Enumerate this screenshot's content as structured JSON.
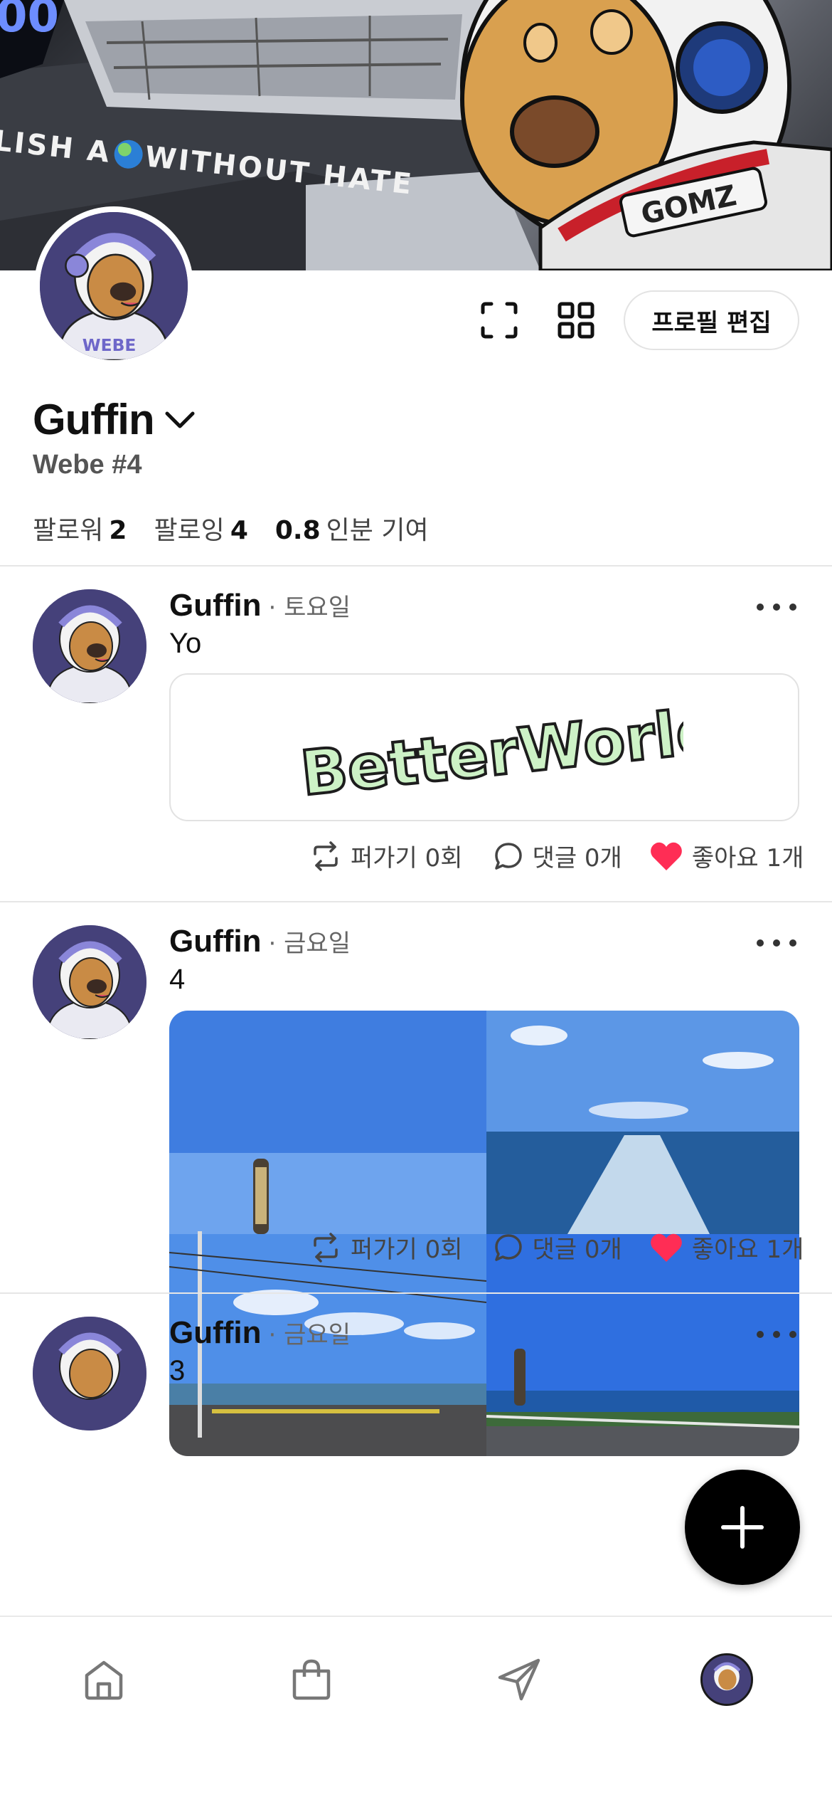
{
  "banner": {
    "text": "LISH A",
    "text_after": "WITHOUT HATE",
    "suit_text": "GOMZ"
  },
  "header": {
    "edit_profile_label": "프로필 편집"
  },
  "profile": {
    "name": "Guffin",
    "handle": "Webe #4",
    "followers_label": "팔로워",
    "followers_count": "2",
    "following_label": "팔로잉",
    "following_count": "4",
    "contribution_value": "0.8",
    "contribution_label": "인분 기여"
  },
  "posts": [
    {
      "author": "Guffin",
      "time": "· 토요일",
      "text": "Yo",
      "link_card_logo": "BetterWorld",
      "repost_label": "퍼가기 0회",
      "comment_label": "댓글 0개",
      "like_label": "좋아요 1개"
    },
    {
      "author": "Guffin",
      "time": "· 금요일",
      "text": "4",
      "repost_label": "퍼가기 0회",
      "comment_label": "댓글 0개",
      "like_label": "좋아요 1개"
    },
    {
      "author": "Guffin",
      "time": "· 금요일",
      "text": "3"
    }
  ],
  "icons": {
    "scan": "scan-icon",
    "grid": "grid-icon",
    "chevron": "chevron-down-icon",
    "more": "more-icon",
    "repost": "repost-icon",
    "comment": "comment-icon",
    "like": "heart-icon",
    "add": "plus-icon",
    "nav_home": "home-icon",
    "nav_shop": "shopping-bag-icon",
    "nav_send": "send-icon"
  },
  "colors": {
    "like": "#ff2d55",
    "fab": "#000000",
    "avatar_bg": "#45417a"
  }
}
